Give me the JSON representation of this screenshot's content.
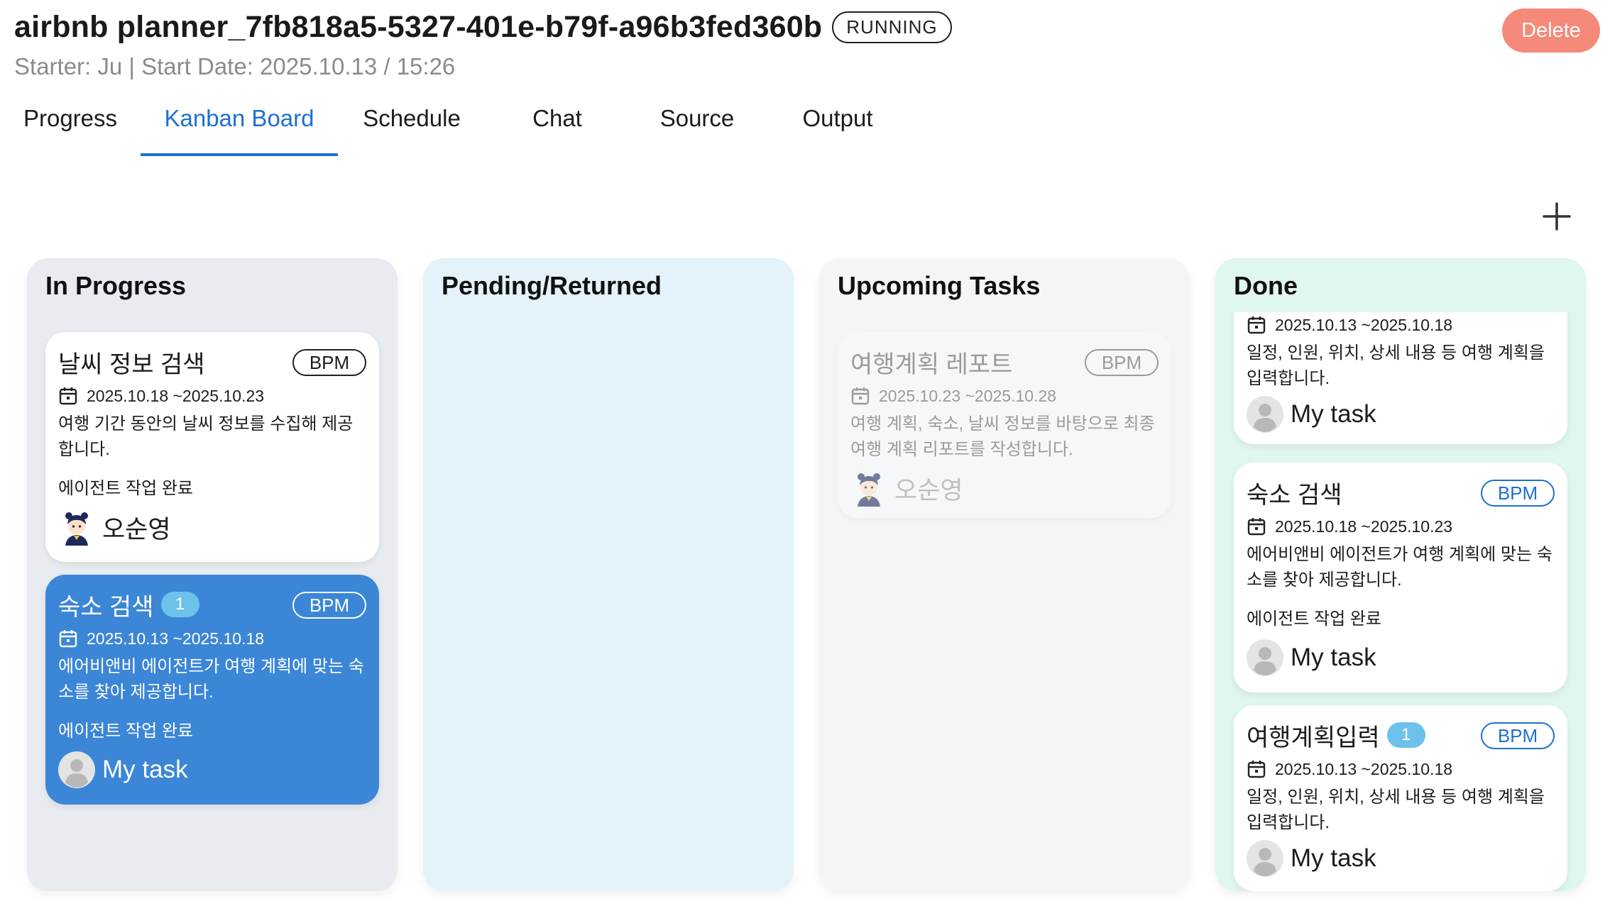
{
  "header": {
    "title": "airbnb planner_7fb818a5-5327-401e-b79f-a96b3fed360b",
    "status": "RUNNING",
    "meta": "Starter: Ju | Start Date: 2025.10.13 / 15:26",
    "delete_label": "Delete"
  },
  "tabs": [
    {
      "label": "Progress"
    },
    {
      "label": "Kanban Board",
      "active": true
    },
    {
      "label": "Schedule"
    },
    {
      "label": "Chat"
    },
    {
      "label": "Source"
    },
    {
      "label": "Output"
    }
  ],
  "columns": {
    "in_progress": {
      "title": "In Progress",
      "cards": [
        {
          "title": "날씨 정보 검색",
          "badge": "BPM",
          "dates": "2025.10.18 ~2025.10.23",
          "desc": "여행 기간 동안의 날씨 정보를 수집해 제공합니다.",
          "status": "에이전트 작업 완료",
          "assignee": "오순영"
        },
        {
          "title": "숙소 검색",
          "count": "1",
          "badge": "BPM",
          "dates": "2025.10.13 ~2025.10.18",
          "desc": "에어비앤비 에이전트가 여행 계획에 맞는 숙소를 찾아 제공합니다.",
          "status": "에이전트 작업 완료",
          "assignee": "My task"
        }
      ]
    },
    "pending": {
      "title": "Pending/Returned",
      "cards": []
    },
    "upcoming": {
      "title": "Upcoming Tasks",
      "cards": [
        {
          "title": "여행계획 레포트",
          "badge": "BPM",
          "dates": "2025.10.23 ~2025.10.28",
          "desc": "여행 계획, 숙소, 날씨 정보를 바탕으로 최종 여행 계획 리포트를 작성합니다.",
          "assignee": "오순영"
        }
      ]
    },
    "done": {
      "title": "Done",
      "cards": [
        {
          "dates": "2025.10.13 ~2025.10.18",
          "desc": "일정, 인원, 위치, 상세 내용 등 여행 계획을 입력합니다.",
          "assignee": "My task"
        },
        {
          "title": "숙소 검색",
          "badge": "BPM",
          "dates": "2025.10.18 ~2025.10.23",
          "desc": "에어비앤비 에이전트가 여행 계획에 맞는 숙소를 찾아 제공합니다.",
          "status": "에이전트 작업 완료",
          "assignee": "My task"
        },
        {
          "title": "여행계획입력",
          "count": "1",
          "badge": "BPM",
          "dates": "2025.10.13 ~2025.10.18",
          "desc": "일정, 인원, 위치, 상세 내용 등 여행 계획을 입력합니다.",
          "assignee": "My task"
        }
      ]
    }
  },
  "colors": {
    "accent": "#1f6fd1",
    "active_card": "#3b86d7",
    "delete": "#f58a7a",
    "count_badge": "#6cc2ea"
  },
  "icons": [
    "calendar-icon",
    "plus-icon",
    "user-avatar-icon",
    "character-avatar-icon"
  ]
}
